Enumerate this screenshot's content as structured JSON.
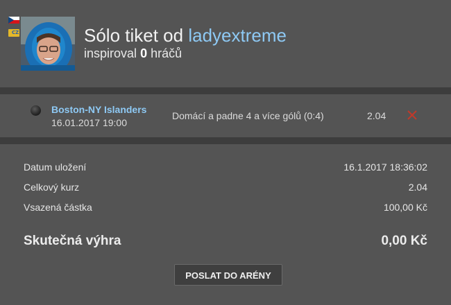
{
  "header": {
    "country_code": "CZ",
    "title_prefix": "Sólo tiket od",
    "username": "ladyextreme",
    "inspired_prefix": "inspiroval",
    "inspired_count": "0",
    "inspired_suffix": "hráčů"
  },
  "bet": {
    "match": "Boston-NY Islanders",
    "datetime": "16.01.2017 19:00",
    "selection": "Domácí a padne 4 a více gólů (0:4)",
    "odds": "2.04"
  },
  "summary": {
    "rows": [
      {
        "label": "Datum uložení",
        "value": "16.1.2017 18:36:02"
      },
      {
        "label": "Celkový kurz",
        "value": "2.04"
      },
      {
        "label": "Vsazená částka",
        "value": "100,00 Kč"
      }
    ],
    "win_label": "Skutečná výhra",
    "win_value": "0,00 Kč"
  },
  "actions": {
    "send_label": "POSLAT DO ARÉNY"
  },
  "colors": {
    "background": "#545454",
    "separator": "#3d3d3d",
    "link": "#8ec9f4",
    "remove": "#c0392b"
  }
}
